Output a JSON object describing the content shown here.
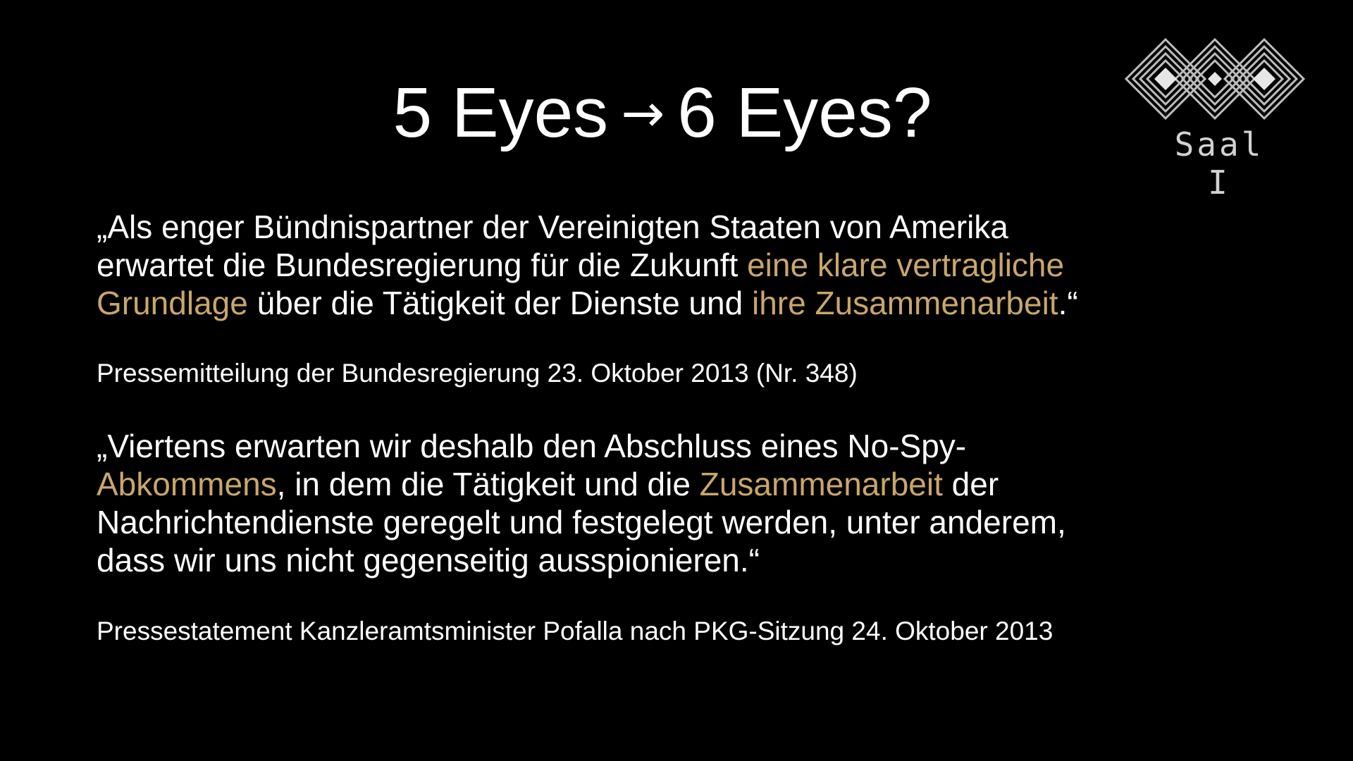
{
  "title": {
    "left": "5 Eyes",
    "arrow": "→",
    "right": "6 Eyes?"
  },
  "logo": {
    "icon": "logo-icon",
    "label": "Saal I"
  },
  "colors": {
    "background": "#000000",
    "text": "#ffffff",
    "highlight": "#c9a66b"
  },
  "quote1": {
    "line1": "„Als enger Bündnispartner der Vereinigten Staaten von Amerika",
    "line2_a": "erwartet die Bundesregierung für die Zukunft ",
    "line2_hl": "eine klare vertragliche",
    "line3_hl1": "Grundlage",
    "line3_b": " über die Tätigkeit der Dienste und ",
    "line3_hl2": "ihre Zusammenarbeit",
    "line3_c": ".“"
  },
  "source1": "Pressemitteilung der Bundesregierung 23. Oktober 2013 (Nr. 348)",
  "quote2": {
    "line1": "„Viertens erwarten wir deshalb den Abschluss eines No-Spy-",
    "line2_hl1": "Abkommens",
    "line2_a": ", in dem die Tätigkeit und die ",
    "line2_hl2": "Zusammenarbeit",
    "line2_b": " der",
    "line3": "Nachrichtendienste geregelt und festgelegt werden, unter anderem,",
    "line4": "dass wir uns nicht gegenseitig ausspionieren.“"
  },
  "source2": "Pressestatement Kanzleramtsminister Pofalla nach PKG-Sitzung 24. Oktober 2013"
}
